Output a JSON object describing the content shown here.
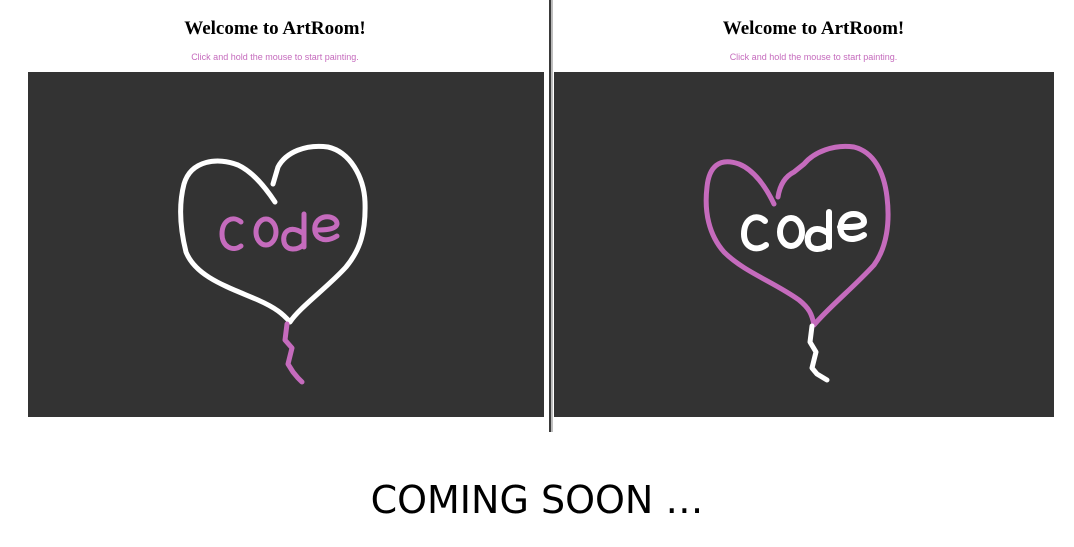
{
  "left_panel": {
    "title": "Welcome to ArtRoom!",
    "instructions": "Click and hold the mouse to start painting.",
    "canvas_color": "#333333",
    "heart_color": "#ffffff",
    "code_color": "#c56bbd",
    "string_color": "#c56bbd"
  },
  "right_panel": {
    "title": "Welcome to ArtRoom!",
    "instructions": "Click and hold the mouse to start painting.",
    "canvas_color": "#333333",
    "heart_color": "#c56bbd",
    "code_color": "#ffffff",
    "string_color": "#ffffff"
  },
  "footer": {
    "coming_soon": "COMING SOON …"
  },
  "colors": {
    "accent": "#c56bbd",
    "canvas": "#333333"
  }
}
